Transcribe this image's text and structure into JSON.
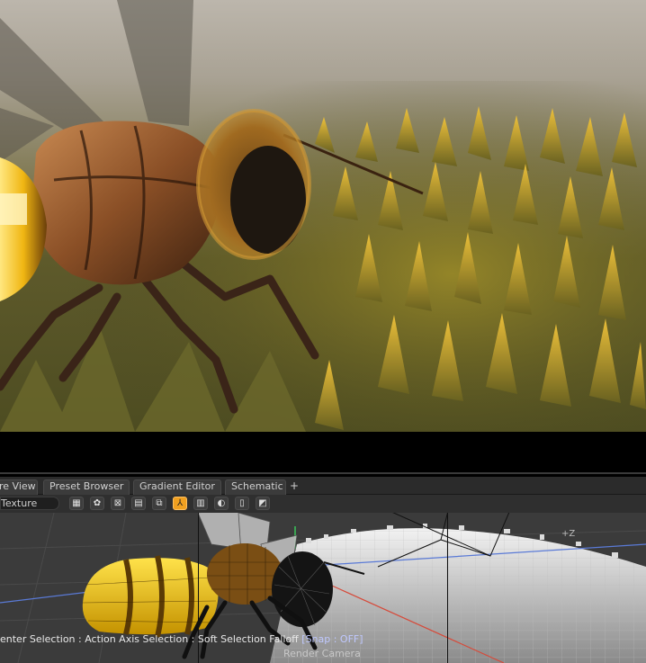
{
  "tabs": [
    {
      "label": "re View"
    },
    {
      "label": "Preset Browser"
    },
    {
      "label": "Gradient Editor"
    },
    {
      "label": "Schematic"
    }
  ],
  "tab_add_label": "+",
  "toolbar": {
    "shading_mode": "Texture",
    "buttons": [
      {
        "icon": "checker-icon",
        "glyph": "▦",
        "active": false
      },
      {
        "icon": "flower-icon",
        "glyph": "✿",
        "active": false
      },
      {
        "icon": "cross-box-icon",
        "glyph": "⊠",
        "active": false
      },
      {
        "icon": "hatch-icon",
        "glyph": "▤",
        "active": false
      },
      {
        "icon": "layers-icon",
        "glyph": "⧉",
        "active": false
      },
      {
        "icon": "axis-icon",
        "glyph": "⅄",
        "active": true
      },
      {
        "icon": "grid-icon",
        "glyph": "▥",
        "active": false
      },
      {
        "icon": "shield-icon",
        "glyph": "◐",
        "active": false
      },
      {
        "icon": "book-icon",
        "glyph": "▯",
        "active": false
      },
      {
        "icon": "diagonal-icon",
        "glyph": "◩",
        "active": false
      }
    ]
  },
  "status": {
    "text": "enter Selection : Action Axis Selection : Soft Selection Falloff ",
    "snap": "[Snap : OFF]"
  },
  "viewport": {
    "camera_label": "Render Camera",
    "axis_label": "+Z"
  },
  "colors": {
    "accent": "#f0a020",
    "panel_bg": "#2b2b2b",
    "viewport_bg": "#3a3a3a"
  }
}
